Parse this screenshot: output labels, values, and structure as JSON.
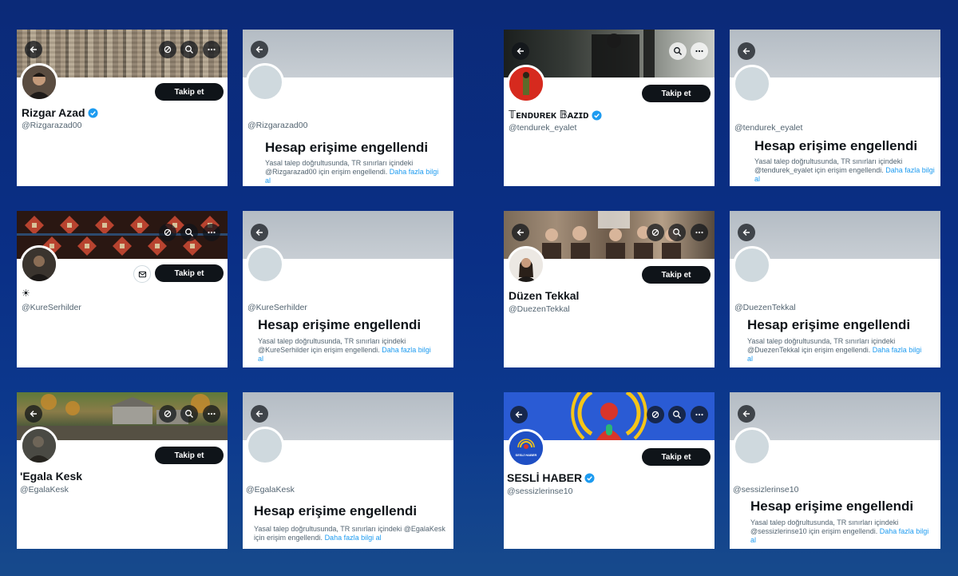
{
  "colors": {
    "accent_link": "#1d9bf0",
    "verified": "#1d9bf0",
    "follow_bg": "#0f1419"
  },
  "profiles": [
    {
      "name": "Rizgar Azad",
      "verified": true,
      "handle": "@Rizgarazad00",
      "follow": "Takip et"
    },
    {
      "name": "𝕋ᴇɴᴅᴜʀᴇᴋ 𝔹ᴀᴢɪᴅ",
      "verified": true,
      "handle": "@tendurek_eyalet",
      "follow": "Takip et"
    },
    {
      "name": "☀",
      "verified": false,
      "handle": "@KureSerhilder",
      "follow": "Takip et"
    },
    {
      "name": "Düzen Tekkal",
      "verified": false,
      "handle": "@DuezenTekkal",
      "follow": "Takip et"
    },
    {
      "name": "'Egala Kesk",
      "verified": false,
      "handle": "@EgalaKesk",
      "follow": "Takip et"
    },
    {
      "name": "SESLİ HABER",
      "verified": true,
      "handle": "@sessizlerinse10",
      "follow": "Takip et"
    }
  ],
  "blocked": [
    {
      "handle": "@Rizgarazad00",
      "title": "Hesap erişime engellendi",
      "text": "Yasal talep doğrultusunda, TR sınırları içindeki @Rizgarazad00 için erişim engellendi.",
      "link": "Daha fazla bilgi al"
    },
    {
      "handle": "@tendurek_eyalet",
      "title": "Hesap erişime engellendi",
      "text": "Yasal talep doğrultusunda, TR sınırları içindeki @tendurek_eyalet için erişim engellendi.",
      "link": "Daha fazla bilgi al"
    },
    {
      "handle": "@KureSerhilder",
      "title": "Hesap erişime engellendi",
      "text": "Yasal talep doğrultusunda, TR sınırları içindeki @KureSerhilder için erişim engellendi.",
      "link": "Daha fazla bilgi al"
    },
    {
      "handle": "@DuezenTekkal",
      "title": "Hesap erişime engellendi",
      "text": "Yasal talep doğrultusunda, TR sınırları içindeki @DuezenTekkal için erişim engellendi.",
      "link": "Daha fazla bilgi al"
    },
    {
      "handle": "@EgalaKesk",
      "title": "Hesap erişime engellendi",
      "text": "Yasal talep doğrultusunda, TR sınırları içindeki @EgalaKesk için erişim engellendi.",
      "link": "Daha fazla bilgi al"
    },
    {
      "handle": "@sessizlerinse10",
      "title": "Hesap erişime engellendi",
      "text": "Yasal talep doğrultusunda, TR sınırları içindeki @sessizlerinse10 için erişim engellendi.",
      "link": "Daha fazla bilgi al"
    }
  ],
  "logo_text": "SESLİ HABER"
}
